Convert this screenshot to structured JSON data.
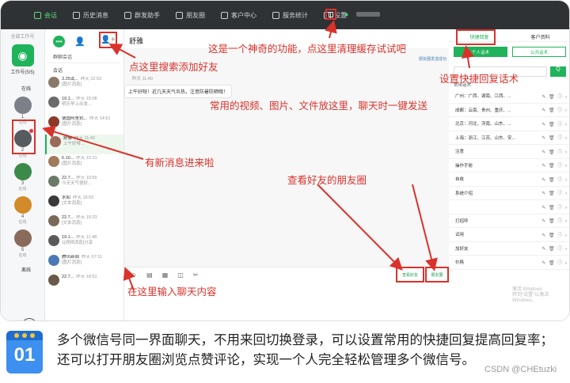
{
  "topbar": {
    "menu": [
      "会话",
      "历史消息",
      "群发助手",
      "朋友圈",
      "客户中心",
      "服务统计",
      "设置"
    ]
  },
  "rail": {
    "top_label": "全部工作号",
    "main_account_label": "工作号(5/5)",
    "online_label": "在线",
    "offline_label": "离线",
    "accounts": [
      {
        "num": "1",
        "tag": "在线",
        "color": "#7c8088"
      },
      {
        "num": "2",
        "tag": "在线",
        "color": "#555b5e"
      },
      {
        "num": "3",
        "tag": "在线",
        "color": "#3c8a4a"
      },
      {
        "num": "4",
        "tag": "在线",
        "color": "#d38a2a"
      },
      {
        "num": "5",
        "tag": "在线",
        "color": "#8a6a5a"
      }
    ]
  },
  "chatlist": {
    "search_label": "群聊会话",
    "section_label": "会话",
    "items": [
      {
        "name": "3.25试...",
        "time": "昨天 22:53",
        "preview": "[图片消息]",
        "color": "#8a7a6a"
      },
      {
        "name": "19.1...",
        "time": "昨天 15:08",
        "preview": "明天早上出发...",
        "color": "#6a6a6a"
      },
      {
        "name": "德国阿里抗...",
        "time": "昨天 14:51",
        "preview": "[图片消息]",
        "color": "#8b3a2a"
      },
      {
        "name": "舒雅",
        "time": "昨天 11:40",
        "preview": "上午好呀...",
        "color": "#9a6a5a"
      },
      {
        "name": "6.10...",
        "time": "昨天 15:21",
        "preview": "[图片消息]",
        "color": "#a07a5a"
      },
      {
        "name": "22.7...",
        "time": "昨天 10:55",
        "preview": "今天天气很好...",
        "color": "#6a7a6a"
      },
      {
        "name": "水如",
        "time": "昨天 16:52",
        "preview": "[文本消息]",
        "color": "#3a3a3a"
      },
      {
        "name": "22.7...",
        "time": "昨天 15:23",
        "preview": "[文本消息]",
        "color": "#7a6a5a"
      },
      {
        "name": "19.1...",
        "time": "昨天 11:48",
        "preview": "1[视频消息]分享",
        "color": "#5a5a5a"
      },
      {
        "name": "腾讯新闻",
        "time": "昨天 07:11",
        "preview": "[图片消息]",
        "color": "#4a7ab5"
      },
      {
        "name": "22.7...",
        "time": "昨天 18:51",
        "preview": "",
        "color": "#6a5a4a"
      }
    ]
  },
  "chat": {
    "title": "舒雅",
    "notice": "朋友圈发送成功",
    "msg_time": "昨天 11:40",
    "message": "上午好呀！近几天天气炎热，注意防暑防晒哦！",
    "btn_friend_label": "查看好友",
    "btn_moment_label": "朋友圈"
  },
  "right": {
    "tab1": "快捷回复",
    "tab2": "客户资料",
    "sub1": "个人话术",
    "sub2": "公共话术",
    "search_btn": "Q",
    "module_label": "常用话术",
    "rows": [
      "广州：广西、湖南、江西、...",
      "成都：云南、贵州、重庆、...",
      "北京：河北、河南、山东、...",
      "上海：浙江、江苏、山东、安...",
      "注意",
      "操作手册",
      "自收",
      "系统介绍",
      "",
      "打招呼",
      "试用",
      "加好友",
      "价格"
    ],
    "row_actions": "✎ 🗑 ⓘ ›"
  },
  "watermark": {
    "line1": "激活 Windows",
    "line2": "转到\"设置\"以激活 Windows。"
  },
  "annotations": {
    "clean_cache": "这是一个神奇的功能，点这里清理缓存试试吧",
    "add_friend": "点这里搜索添加好友",
    "quick_reply": "设置快捷回复话术",
    "media": "常用的视频、图片、文件放这里，聊天时一键发送",
    "new_msg": "有新消息进来啦",
    "moments": "查看好友的朋友圈",
    "input_here": "在这里输入聊天内容"
  },
  "caption": {
    "num": "01",
    "text": "多个微信号同一界面聊天，不用来回切换登录，可以设置常用的快捷回复提高回复率；还可以打开朋友圈浏览点赞评论，实现一个人完全轻松管理多个微信号。",
    "credit": "CSDN @CHEtuzki"
  }
}
